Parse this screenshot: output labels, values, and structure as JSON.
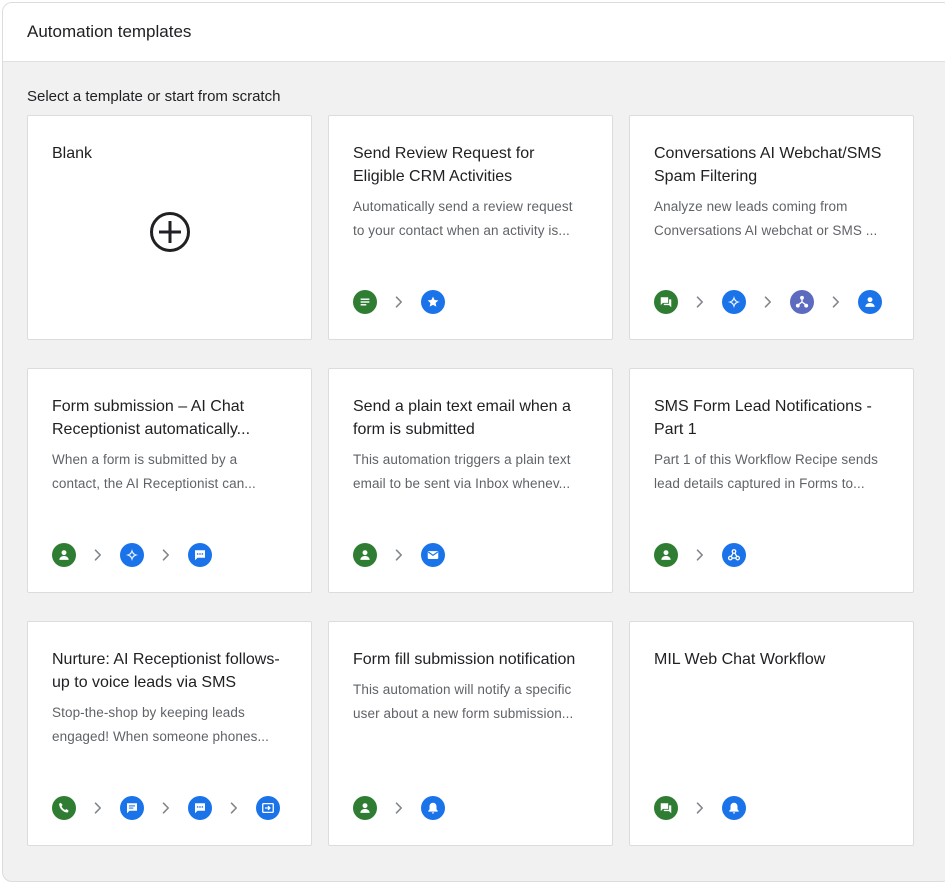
{
  "header": {
    "title": "Automation templates"
  },
  "subtitle": "Select a template or start from scratch",
  "colors": {
    "green": "#2e7d32",
    "blue": "#1a73e8",
    "purple": "#5c6bc0"
  },
  "cards": [
    {
      "title_lines": [
        "Blank"
      ],
      "desc_lines": [],
      "blank_icon": "add-circle-icon",
      "steps": []
    },
    {
      "title_lines": [
        "Send Review Request for",
        "Eligible CRM Activities"
      ],
      "desc_lines": [
        "Automatically send a review request",
        "to your contact when an activity is..."
      ],
      "steps": [
        {
          "icon": "notes-icon",
          "color": "#2e7d32"
        },
        {
          "icon": "star-icon",
          "color": "#1a73e8"
        }
      ]
    },
    {
      "title_lines": [
        "Conversations AI Webchat/SMS",
        "Spam Filtering"
      ],
      "desc_lines": [
        "Analyze new leads coming from",
        "Conversations AI webchat or SMS ..."
      ],
      "steps": [
        {
          "icon": "forum-icon",
          "color": "#2e7d32"
        },
        {
          "icon": "sparkle-icon",
          "color": "#1a73e8"
        },
        {
          "icon": "branch-icon",
          "color": "#5c6bc0"
        },
        {
          "icon": "person-icon",
          "color": "#1a73e8"
        }
      ]
    },
    {
      "title_lines": [
        "Form submission – AI Chat",
        "Receptionist automatically..."
      ],
      "desc_lines": [
        "When a form is submitted by a",
        "contact, the AI Receptionist can..."
      ],
      "steps": [
        {
          "icon": "person-icon",
          "color": "#2e7d32"
        },
        {
          "icon": "sparkle-icon",
          "color": "#1a73e8"
        },
        {
          "icon": "chat-icon",
          "color": "#1a73e8"
        }
      ]
    },
    {
      "title_lines": [
        "Send a plain text email when a",
        "form is submitted"
      ],
      "desc_lines": [
        "This automation triggers a plain text",
        "email to be sent via Inbox whenev..."
      ],
      "steps": [
        {
          "icon": "person-icon",
          "color": "#2e7d32"
        },
        {
          "icon": "mail-icon",
          "color": "#1a73e8"
        }
      ]
    },
    {
      "title_lines": [
        "SMS Form Lead Notifications -",
        "Part 1"
      ],
      "desc_lines": [
        "Part 1 of this Workflow Recipe sends",
        "lead details captured in Forms to..."
      ],
      "steps": [
        {
          "icon": "person-icon",
          "color": "#2e7d32"
        },
        {
          "icon": "webhook-icon",
          "color": "#1a73e8"
        }
      ]
    },
    {
      "title_lines": [
        "Nurture: AI Receptionist follows-",
        "up to voice leads via SMS"
      ],
      "desc_lines": [
        "Stop-the-shop by keeping leads",
        "engaged! When someone phones..."
      ],
      "steps": [
        {
          "icon": "phone-icon",
          "color": "#2e7d32"
        },
        {
          "icon": "message-icon",
          "color": "#1a73e8"
        },
        {
          "icon": "chat-icon",
          "color": "#1a73e8"
        },
        {
          "icon": "input-icon",
          "color": "#1a73e8"
        }
      ]
    },
    {
      "title_lines": [
        "Form fill submission notification"
      ],
      "desc_lines": [
        "This automation will notify a specific",
        "user about a new form submission..."
      ],
      "steps": [
        {
          "icon": "person-icon",
          "color": "#2e7d32"
        },
        {
          "icon": "bell-icon",
          "color": "#1a73e8"
        }
      ]
    },
    {
      "title_lines": [
        "MIL Web Chat Workflow"
      ],
      "desc_lines": [],
      "steps": [
        {
          "icon": "forum-icon",
          "color": "#2e7d32"
        },
        {
          "icon": "bell-icon",
          "color": "#1a73e8"
        }
      ]
    }
  ]
}
